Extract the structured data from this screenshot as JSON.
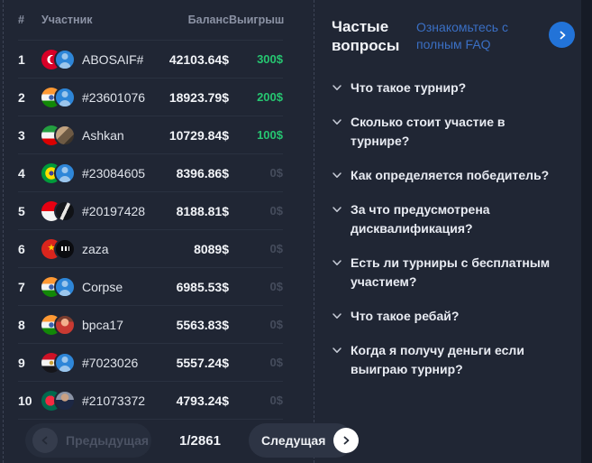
{
  "table": {
    "headers": {
      "rank": "#",
      "participant": "Участник",
      "balance": "Баланс",
      "win": "Выигрыш"
    },
    "rows": [
      {
        "rank": "1",
        "name": "ABOSAIF#",
        "balance": "42103.64$",
        "win": "300$",
        "win_state": "positive",
        "flag": "turkey",
        "avatar": "user-blue"
      },
      {
        "rank": "2",
        "name": "#23601076",
        "balance": "18923.79$",
        "win": "200$",
        "win_state": "positive",
        "flag": "india",
        "avatar": "user-blue"
      },
      {
        "rank": "3",
        "name": "Ashkan",
        "balance": "10729.84$",
        "win": "100$",
        "win_state": "positive",
        "flag": "iran",
        "avatar": "photo-tan"
      },
      {
        "rank": "4",
        "name": "#23084605",
        "balance": "8396.86$",
        "win": "0$",
        "win_state": "zero",
        "flag": "brazil",
        "avatar": "user-blue"
      },
      {
        "rank": "5",
        "name": "#20197428",
        "balance": "8188.81$",
        "win": "0$",
        "win_state": "zero",
        "flag": "indonesia",
        "avatar": "photo-dark"
      },
      {
        "rank": "6",
        "name": "zaza",
        "balance": "8089$",
        "win": "0$",
        "win_state": "zero",
        "flag": "vietnam",
        "avatar": "black-badge"
      },
      {
        "rank": "7",
        "name": "Corpse",
        "balance": "6985.53$",
        "win": "0$",
        "win_state": "zero",
        "flag": "india",
        "avatar": "user-blue"
      },
      {
        "rank": "8",
        "name": "bpca17",
        "balance": "5563.83$",
        "win": "0$",
        "win_state": "zero",
        "flag": "india",
        "avatar": "cartoon-red"
      },
      {
        "rank": "9",
        "name": "#7023026",
        "balance": "5557.24$",
        "win": "0$",
        "win_state": "zero",
        "flag": "egypt",
        "avatar": "user-blue"
      },
      {
        "rank": "10",
        "name": "#21073372",
        "balance": "4793.24$",
        "win": "0$",
        "win_state": "zero",
        "flag": "bangladesh",
        "avatar": "photo-suit"
      }
    ]
  },
  "pagination": {
    "prev_label": "Предыдущая",
    "page_indicator": "1/2861",
    "next_label": "Следущая"
  },
  "faq": {
    "title": "Частые вопросы",
    "link_label": "Ознакомьтесь с полным FAQ",
    "questions": [
      {
        "label": "Что такое турнир?"
      },
      {
        "label": "Сколько стоит участие в турнире?"
      },
      {
        "label": "Как определяется победитель?"
      },
      {
        "label": "За что предусмотрена дисквалификация?"
      },
      {
        "label": "Есть ли турниры с бесплатным участием?"
      },
      {
        "label": "Что такое ребай?"
      },
      {
        "label": "Когда я получу деньги если выиграю турнир?"
      }
    ]
  },
  "icons": {
    "faq_circle": "chevron-right-icon",
    "question_toggle": "chevron-down-icon",
    "prev_button": "chevron-left-icon",
    "next_button": "chevron-right-icon"
  },
  "colors": {
    "background": "#202634",
    "accent_green": "#26c671",
    "accent_blue": "#2273d8",
    "link_blue": "#3a6fc4",
    "zero_gray": "#454c5c",
    "separator": "#2a3140"
  }
}
